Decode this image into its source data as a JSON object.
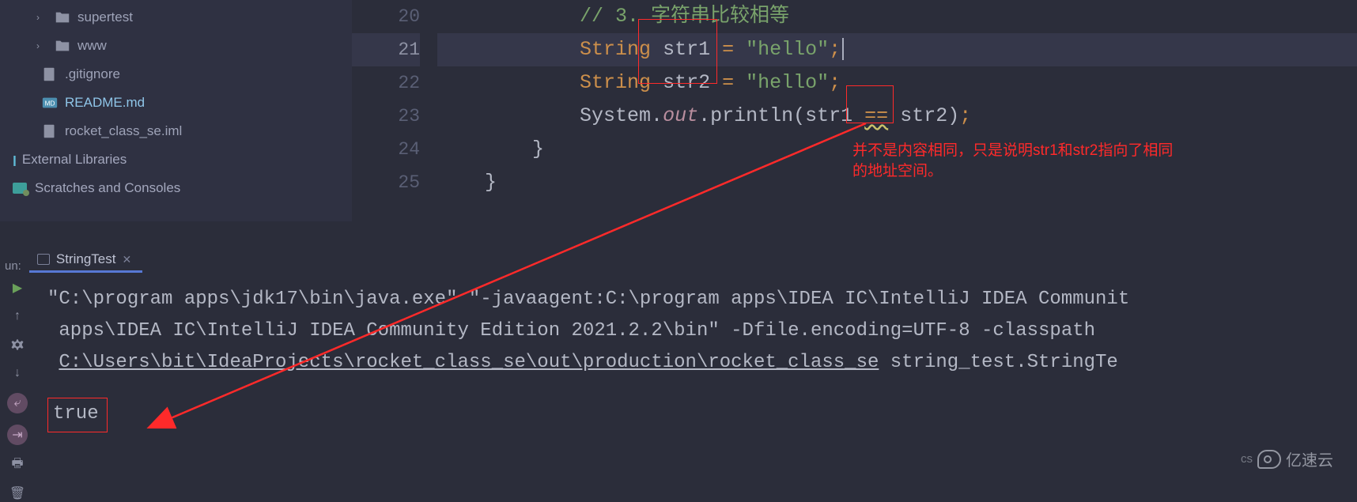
{
  "sidebar": {
    "items": [
      {
        "chev": "›",
        "icon": "folder",
        "label": "supertest"
      },
      {
        "chev": "›",
        "icon": "folder",
        "label": "www"
      },
      {
        "chev": "",
        "icon": "git",
        "label": ".gitignore"
      },
      {
        "chev": "",
        "icon": "md",
        "label": "README.md"
      },
      {
        "chev": "",
        "icon": "iml",
        "label": "rocket_class_se.iml"
      }
    ],
    "external": "External Libraries",
    "scratches": "Scratches and Consoles"
  },
  "code": {
    "lines": [
      "20",
      "21",
      "22",
      "23",
      "24",
      "25"
    ],
    "comment": "// 3. 字符串比较相等",
    "kw_string": "String",
    "v1": "str1",
    "v2": "str2",
    "lit": "\"hello\"",
    "sys": "System",
    "out": "out",
    "println": "println",
    "eq": "==",
    "brace": "}"
  },
  "annotation": {
    "text1": "并不是内容相同，只是说明str1和str2指向了相同",
    "text2": "的地址空间。"
  },
  "run": {
    "label": "un:",
    "tab": "StringTest"
  },
  "console": {
    "l1a": "\"C:\\program apps\\jdk17\\bin\\java.exe\" \"-javaagent:C:\\program apps\\IDEA IC\\IntelliJ IDEA Communit",
    "l2a": "apps\\IDEA IC\\IntelliJ IDEA Community Edition 2021.2.2\\bin\" -Dfile.encoding=UTF-8 -classpath ",
    "l3path": "C:\\Users\\bit\\IdeaProjects\\rocket_class_se\\out\\production\\rocket_class_se",
    "l3b": " string_test.StringTe",
    "result": "true"
  },
  "watermark": "亿速云",
  "cs": "cs"
}
